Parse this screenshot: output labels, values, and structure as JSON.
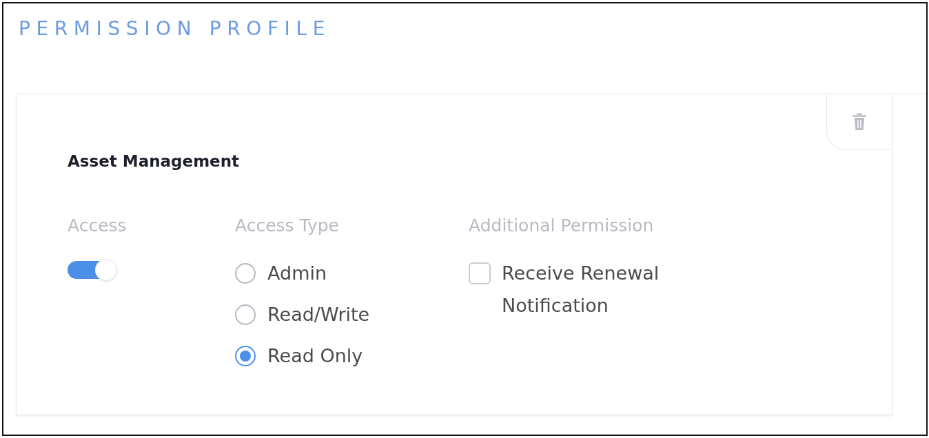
{
  "header": {
    "title": "PERMISSION PROFILE"
  },
  "module": {
    "title": "Asset Management",
    "access": {
      "label": "Access",
      "on": true
    },
    "access_type": {
      "label": "Access Type",
      "options": [
        {
          "label": "Admin",
          "selected": false
        },
        {
          "label": "Read/Write",
          "selected": false
        },
        {
          "label": "Read Only",
          "selected": true
        }
      ]
    },
    "additional_permission": {
      "label": "Additional Permission",
      "options": [
        {
          "label": "Receive Renewal Notification",
          "checked": false
        }
      ]
    }
  }
}
